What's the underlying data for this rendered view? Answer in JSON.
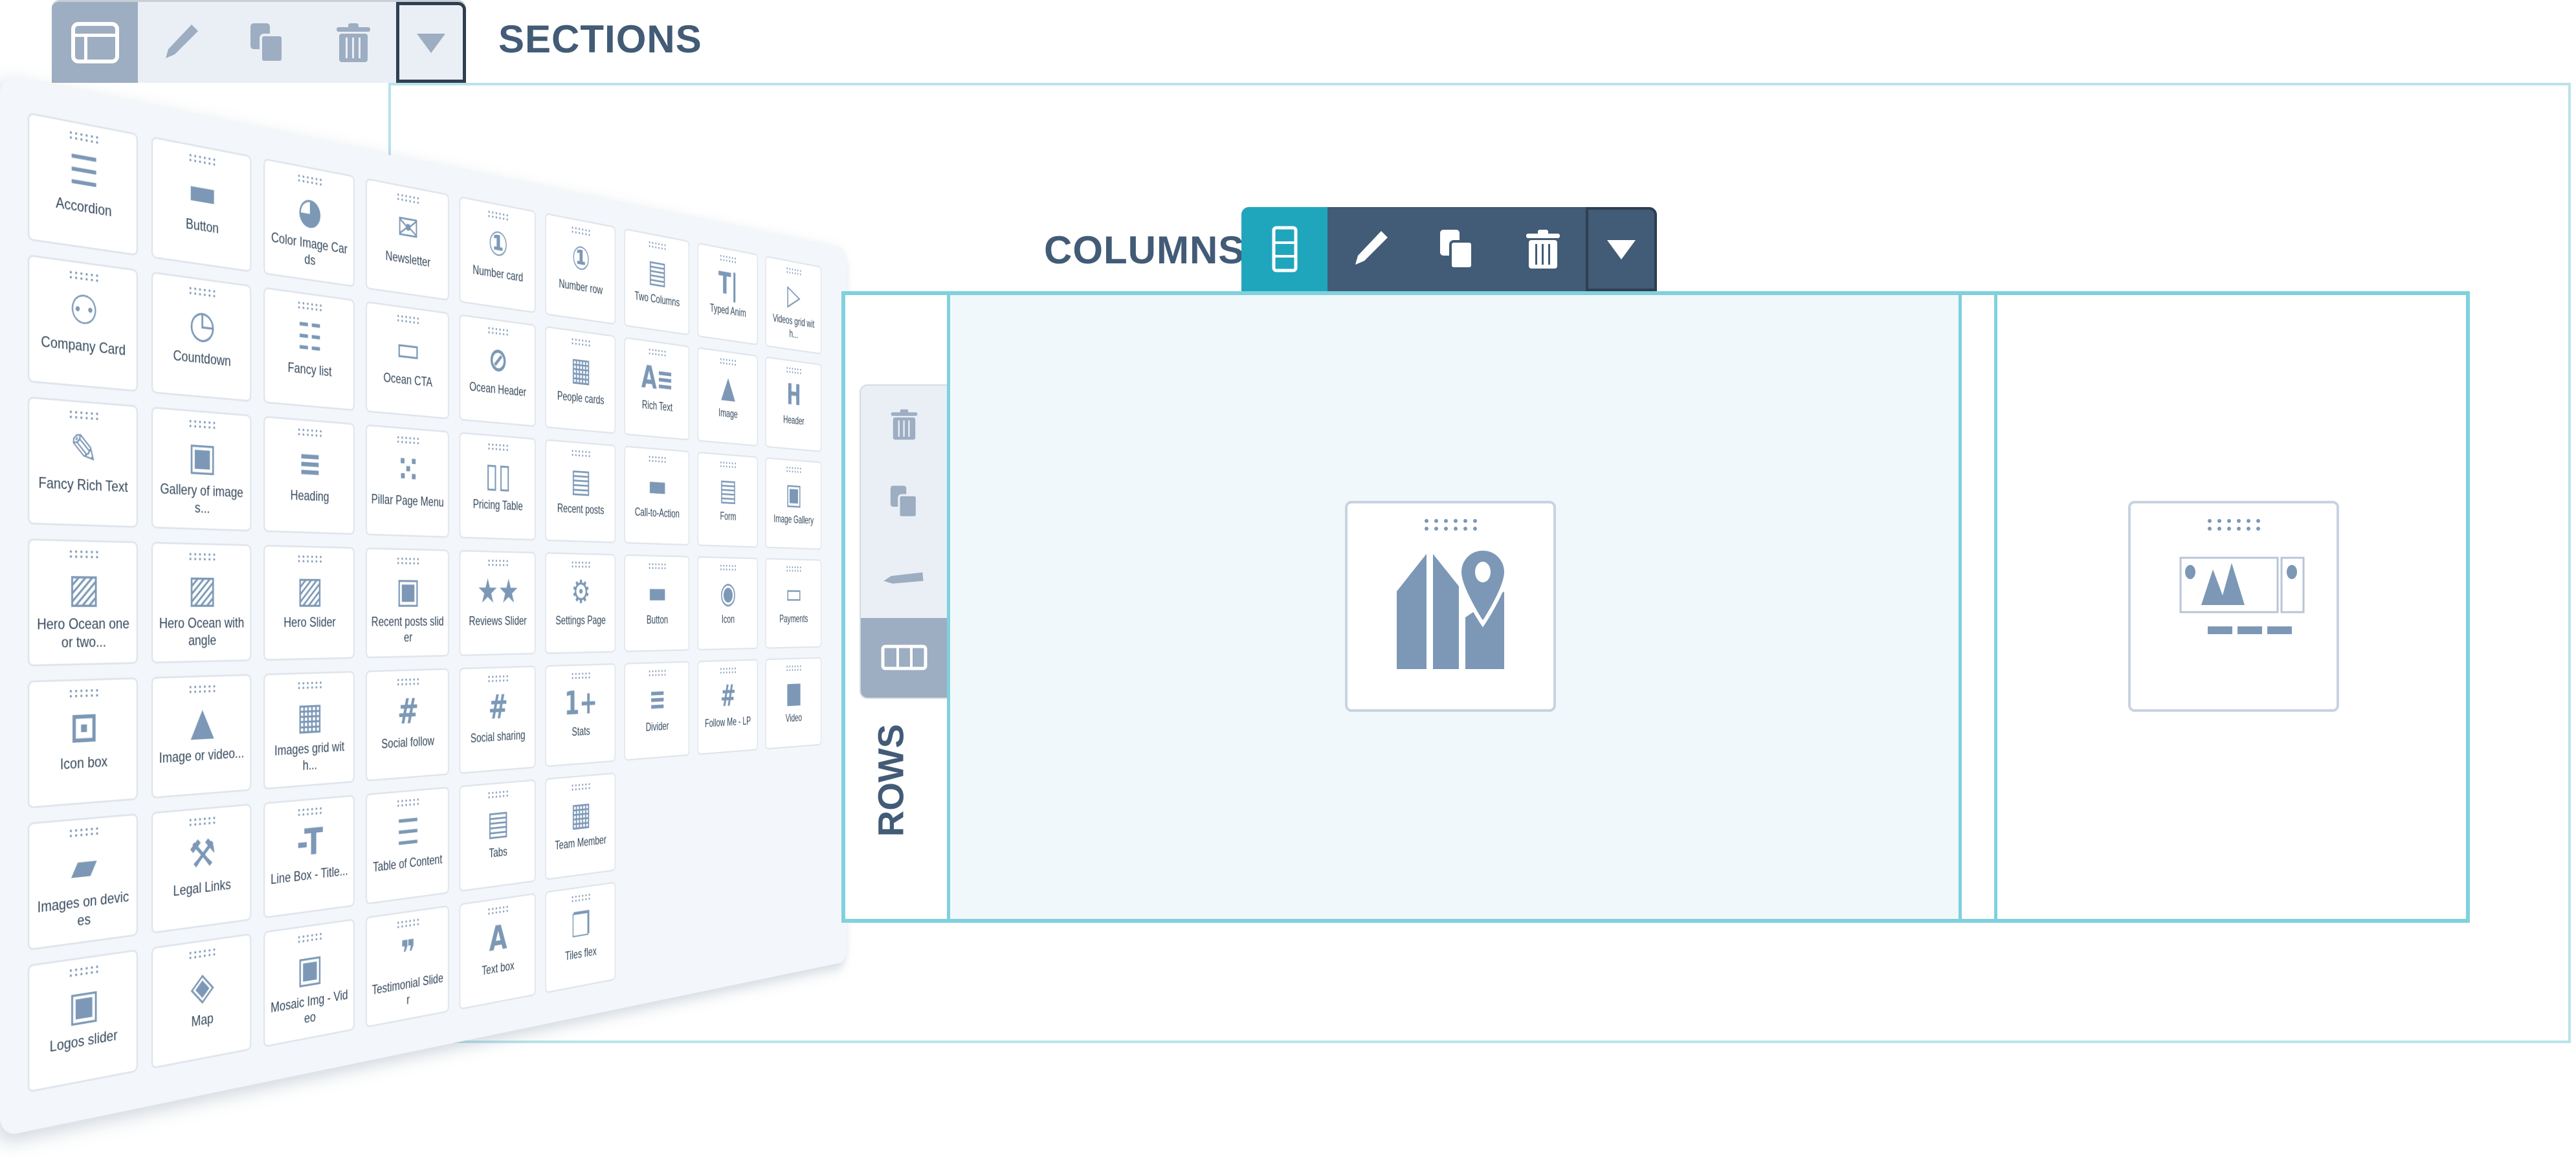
{
  "sections_toolbar": {
    "label": "SECTIONS",
    "buttons": [
      {
        "icon": "layout-icon",
        "active": true
      },
      {
        "icon": "pencil-icon"
      },
      {
        "icon": "copy-icon"
      },
      {
        "icon": "trash-icon"
      },
      {
        "icon": "caret-down-icon"
      }
    ]
  },
  "columns_toolbar": {
    "label": "COLUMNS",
    "buttons": [
      {
        "icon": "rows-layout-icon",
        "active": true
      },
      {
        "icon": "pencil-icon"
      },
      {
        "icon": "copy-icon"
      },
      {
        "icon": "trash-icon"
      },
      {
        "icon": "caret-down-icon"
      }
    ]
  },
  "rows_toolbar": {
    "label": "ROWS",
    "buttons": [
      {
        "icon": "trash-icon"
      },
      {
        "icon": "copy-icon"
      },
      {
        "icon": "pencil-icon"
      },
      {
        "icon": "columns-layout-icon",
        "active": true
      }
    ]
  },
  "canvas": {
    "modules": [
      {
        "icon": "map-icon"
      },
      {
        "icon": "image-gallery-icon"
      }
    ]
  },
  "colors": {
    "accent": "#1fa6bd",
    "frame": "#7fd1dd",
    "toolbar_dark": "#425b76",
    "icon": "#7c98b6",
    "panel_bg": "#f3f6fa"
  },
  "modules_panel": {
    "columns": [
      [
        {
          "label": "Accordion",
          "icon": "accordion"
        },
        {
          "label": "Company Card",
          "icon": "hubspot"
        },
        {
          "label": "Fancy Rich Text",
          "icon": "pencil"
        },
        {
          "label": "Hero Ocean one or two...",
          "icon": "hero"
        },
        {
          "label": "Icon box",
          "icon": "iconbox"
        },
        {
          "label": "Images on devices",
          "icon": "devices"
        },
        {
          "label": "Logos slider",
          "icon": "gallery"
        }
      ],
      [
        {
          "label": "Button",
          "icon": "button"
        },
        {
          "label": "Countdown",
          "icon": "clock"
        },
        {
          "label": "Gallery of images...",
          "icon": "gallery"
        },
        {
          "label": "Hero Ocean with angle",
          "icon": "hero"
        },
        {
          "label": "Image or video...",
          "icon": "image"
        },
        {
          "label": "Legal Links",
          "icon": "gavel"
        },
        {
          "label": "Map",
          "icon": "map"
        }
      ],
      [
        {
          "label": "Color Image Cards",
          "icon": "palette"
        },
        {
          "label": "Fancy list",
          "icon": "list"
        },
        {
          "label": "Heading",
          "icon": "heading"
        },
        {
          "label": "Hero Slider",
          "icon": "hero"
        },
        {
          "label": "Images grid with...",
          "icon": "people"
        },
        {
          "label": "Line Box - Title...",
          "icon": "linetitle"
        },
        {
          "label": "Mosaic Img - Video",
          "icon": "gallery"
        }
      ],
      [
        {
          "label": "Newsletter",
          "icon": "envelope"
        },
        {
          "label": "Ocean CTA",
          "icon": "cta"
        },
        {
          "label": "Pillar Page Menu",
          "icon": "grid"
        },
        {
          "label": "Recent posts slider",
          "icon": "gallery"
        },
        {
          "label": "Social follow",
          "icon": "hashtag"
        },
        {
          "label": "Table of Content",
          "icon": "toc"
        },
        {
          "label": "Testimonial Slider",
          "icon": "testimonial"
        }
      ],
      [
        {
          "label": "Number card",
          "icon": "number"
        },
        {
          "label": "Ocean Header",
          "icon": "compass"
        },
        {
          "label": "Pricing Table",
          "icon": "pricing"
        },
        {
          "label": "Reviews Slider",
          "icon": "stars"
        },
        {
          "label": "Social sharing",
          "icon": "hashtag"
        },
        {
          "label": "Tabs",
          "icon": "tabs"
        },
        {
          "label": "Text box",
          "icon": "textbox"
        }
      ],
      [
        {
          "label": "Number row",
          "icon": "number"
        },
        {
          "label": "People cards",
          "icon": "people"
        },
        {
          "label": "Recent posts",
          "icon": "news"
        },
        {
          "label": "Settings Page",
          "icon": "gear"
        },
        {
          "label": "Stats",
          "icon": "stats"
        },
        {
          "label": "Team Member",
          "icon": "people"
        },
        {
          "label": "Tiles flex",
          "icon": "tiles"
        }
      ],
      [
        {
          "label": "Two Columns",
          "icon": "twocol"
        },
        {
          "label": "Rich Text",
          "icon": "richtext"
        },
        {
          "label": "Call-to-Action",
          "icon": "button"
        },
        {
          "label": "Button",
          "icon": "button"
        },
        {
          "label": "Divider",
          "icon": "divider"
        }
      ],
      [
        {
          "label": "Typed Anim",
          "icon": "typed"
        },
        {
          "label": "Image",
          "icon": "image"
        },
        {
          "label": "Form",
          "icon": "form"
        },
        {
          "label": "Icon",
          "icon": "badge"
        },
        {
          "label": "Follow Me - LP",
          "icon": "hashtag"
        }
      ],
      [
        {
          "label": "Videos grid with...",
          "icon": "videogrid"
        },
        {
          "label": "Header",
          "icon": "header"
        },
        {
          "label": "Image Gallery",
          "icon": "gallery"
        },
        {
          "label": "Payments",
          "icon": "payment"
        },
        {
          "label": "Video",
          "icon": "video"
        }
      ]
    ]
  }
}
